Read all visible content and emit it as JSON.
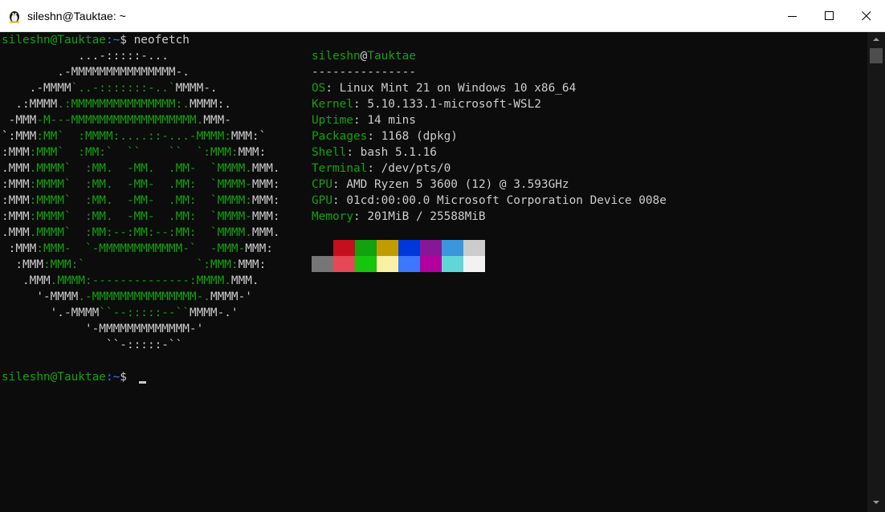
{
  "window": {
    "title": "sileshn@Tauktae: ~"
  },
  "icons": {
    "app": "linux-penguin-icon",
    "minimize": "minimize-icon",
    "maximize": "maximize-icon",
    "close": "close-icon"
  },
  "terminal": {
    "prompt_user_host": "sileshn@Tauktae",
    "prompt_path": ":~",
    "prompt_symbol": "$",
    "command": " neofetch",
    "logo": [
      [
        [
          "w",
          "           ...-:::::-..."
        ]
      ],
      [
        [
          "w",
          "        .-MMMMMMMMMMMMMMM-."
        ]
      ],
      [
        [
          "w",
          "    .-MMMM"
        ],
        [
          "g",
          "`..-:::::::-..`"
        ],
        [
          "w",
          "MMMM-."
        ]
      ],
      [
        [
          "w",
          "  .:MMMM"
        ],
        [
          "g",
          ".:MMMMMMMMMMMMMMM:."
        ],
        [
          "w",
          "MMMM:."
        ]
      ],
      [
        [
          "w",
          " -MMM"
        ],
        [
          "g",
          "-M---MMMMMMMMMMMMMMMMMM."
        ],
        [
          "w",
          "MMM-"
        ]
      ],
      [
        [
          "w",
          "`:MMM"
        ],
        [
          "g",
          ":MM`  :MMMM:....::-...-MMMM:"
        ],
        [
          "w",
          "MMM:`"
        ]
      ],
      [
        [
          "w",
          ":MMM"
        ],
        [
          "g",
          ":MMM`  :MM:`  ``    ``  `:MMM:"
        ],
        [
          "w",
          "MMM:"
        ]
      ],
      [
        [
          "w",
          ".MMM"
        ],
        [
          "g",
          ".MMMM`  :MM.  -MM.  .MM-  `MMMM."
        ],
        [
          "w",
          "MMM."
        ]
      ],
      [
        [
          "w",
          ":MMM"
        ],
        [
          "g",
          ":MMMM`  :MM.  -MM-  .MM:  `MMMM-"
        ],
        [
          "w",
          "MMM:"
        ]
      ],
      [
        [
          "w",
          ":MMM"
        ],
        [
          "g",
          ":MMMM`  :MM.  -MM-  .MM:  `MMMM:"
        ],
        [
          "w",
          "MMM:"
        ]
      ],
      [
        [
          "w",
          ":MMM"
        ],
        [
          "g",
          ":MMMM`  :MM.  -MM-  .MM:  `MMMM-"
        ],
        [
          "w",
          "MMM:"
        ]
      ],
      [
        [
          "w",
          ".MMM"
        ],
        [
          "g",
          ".MMMM`  :MM:--:MM:--:MM:  `MMMM."
        ],
        [
          "w",
          "MMM."
        ]
      ],
      [
        [
          "w",
          " :MMM"
        ],
        [
          "g",
          ":MMM-  `-MMMMMMMMMMMM-`  -MMM-"
        ],
        [
          "w",
          "MMM:"
        ]
      ],
      [
        [
          "w",
          "  :MMM"
        ],
        [
          "g",
          ":MMM:`                `:MMM:"
        ],
        [
          "w",
          "MMM:"
        ]
      ],
      [
        [
          "w",
          "   .MMM"
        ],
        [
          "g",
          ".MMMM:--------------:MMMM."
        ],
        [
          "w",
          "MMM."
        ]
      ],
      [
        [
          "w",
          "     '-MMMM"
        ],
        [
          "g",
          ".-MMMMMMMMMMMMMMM-."
        ],
        [
          "w",
          "MMMM-'"
        ]
      ],
      [
        [
          "w",
          "       '.-MMMM"
        ],
        [
          "g",
          "``--:::::--``"
        ],
        [
          "w",
          "MMMM-.'"
        ]
      ],
      [
        [
          "w",
          "            '-MMMMMMMMMMMMM-'"
        ]
      ],
      [
        [
          "w",
          "               ``-:::::-``"
        ]
      ]
    ],
    "info": {
      "user": "sileshn",
      "at": "@",
      "host": "Tauktae",
      "separator": "---------------",
      "fields": [
        {
          "key": "OS",
          "value": "Linux Mint 21 on Windows 10 x86_64"
        },
        {
          "key": "Kernel",
          "value": "5.10.133.1-microsoft-WSL2"
        },
        {
          "key": "Uptime",
          "value": "14 mins"
        },
        {
          "key": "Packages",
          "value": "1168 (dpkg)"
        },
        {
          "key": "Shell",
          "value": "bash 5.1.16"
        },
        {
          "key": "Terminal",
          "value": "/dev/pts/0"
        },
        {
          "key": "CPU",
          "value": "AMD Ryzen 5 3600 (12) @ 3.593GHz"
        },
        {
          "key": "GPU",
          "value": "01cd:00:00.0 Microsoft Corporation Device 008e"
        },
        {
          "key": "Memory",
          "value": "201MiB / 25588MiB"
        }
      ],
      "key_separator": ": "
    },
    "palette_normal": [
      "#0c0c0c",
      "#c50f1f",
      "#13a10e",
      "#c19c00",
      "#0037da",
      "#881798",
      "#3a96dd",
      "#cccccc"
    ],
    "palette_bright": [
      "#767676",
      "#e74856",
      "#16c60c",
      "#f9f1a5",
      "#3b78ff",
      "#b4009e",
      "#61d6d6",
      "#f2f2f2"
    ]
  }
}
